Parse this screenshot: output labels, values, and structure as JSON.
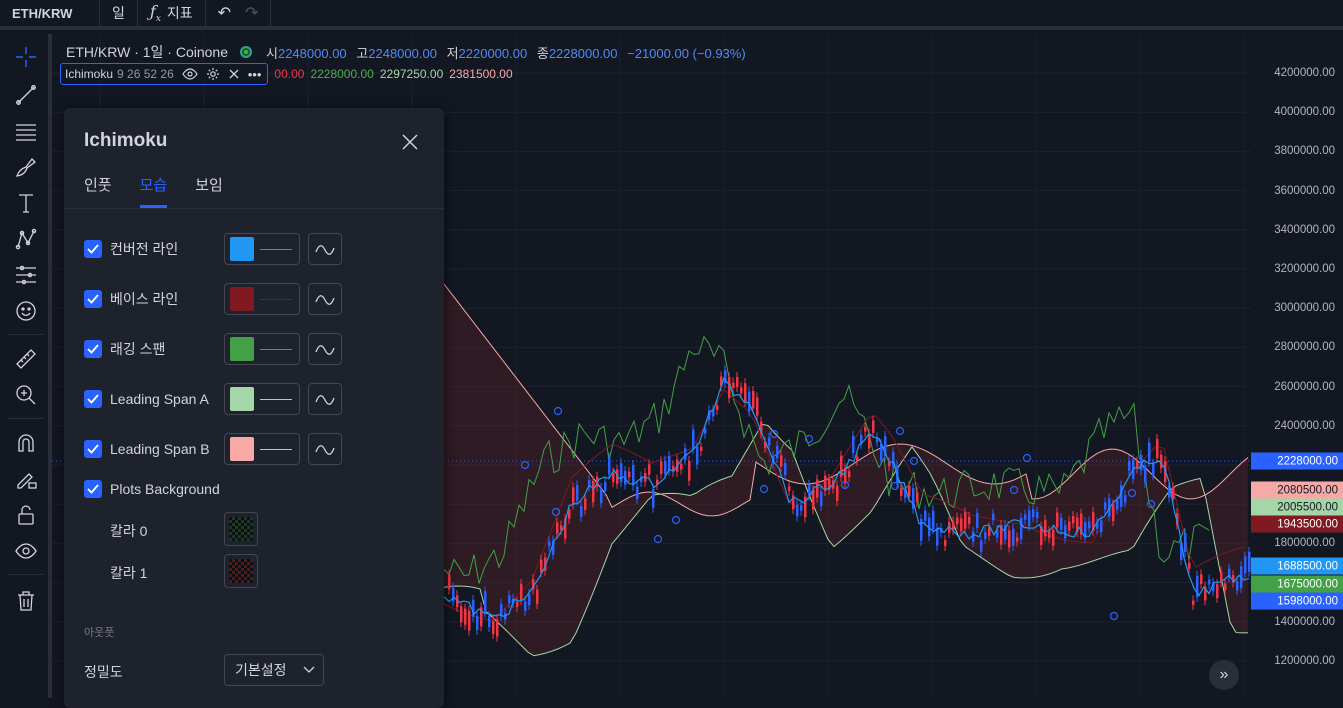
{
  "topbar": {
    "symbol": "ETH/KRW",
    "interval": "일",
    "indicators_label": "지표"
  },
  "legend": {
    "title": "ETH/KRW · 1일 · Coinone",
    "open_label": "시",
    "open": "2248000.00",
    "high_label": "고",
    "high": "2248000.00",
    "low_label": "저",
    "low": "2220000.00",
    "close_label": "종",
    "close": "2228000.00",
    "change": "−21000.00 (−0.93%)"
  },
  "indicator": {
    "name": "Ichimoku",
    "params": "9 26 52 26",
    "values": [
      {
        "text": "00.00",
        "color": "#f23645"
      },
      {
        "text": "2228000.00",
        "color": "#4caf50"
      },
      {
        "text": "2297250.00",
        "color": "#a5d6a7"
      },
      {
        "text": "2381500.00",
        "color": "#f7a9a8"
      }
    ]
  },
  "price_axis": {
    "labels": [
      "4200000.00",
      "4000000.00",
      "3800000.00",
      "3600000.00",
      "3400000.00",
      "3200000.00",
      "3000000.00",
      "2800000.00",
      "2600000.00",
      "2400000.00",
      "1800000.00",
      "1400000.00",
      "1200000.00"
    ],
    "tags": [
      {
        "text": "2228000.00",
        "bg": "#2962ff",
        "fg": "#ffffff"
      },
      {
        "text": "2080500.00",
        "bg": "#f7a9a8",
        "fg": "#131722"
      },
      {
        "text": "2005500.00",
        "bg": "#a5d6a7",
        "fg": "#131722"
      },
      {
        "text": "1943500.00",
        "bg": "#801922",
        "fg": "#ffffff"
      },
      {
        "text": "1688500.00",
        "bg": "#2196f3",
        "fg": "#ffffff"
      },
      {
        "text": "1675000.00",
        "bg": "#43a047",
        "fg": "#ffffff"
      },
      {
        "text": "1598000.00",
        "bg": "#2962ff",
        "fg": "#ffffff"
      }
    ]
  },
  "dialog": {
    "title": "Ichimoku",
    "tabs": [
      "인풋",
      "모습",
      "보임"
    ],
    "active_tab": "모습",
    "lines": [
      {
        "label": "컨버전 라인",
        "color": "#2196f3"
      },
      {
        "label": "베이스 라인",
        "color": "#801922"
      },
      {
        "label": "래깅 스팬",
        "color": "#43a047"
      },
      {
        "label": "Leading Span A",
        "color": "#a5d6a7"
      },
      {
        "label": "Leading Span B",
        "color": "#f7a9a8"
      }
    ],
    "plots_background": "Plots Background",
    "color0_label": "칼라 0",
    "color1_label": "칼라 1",
    "color0": "#1b3a1e",
    "color1": "#4a1c1c",
    "outputs_label": "아웃풋",
    "precision_label": "정밀도",
    "precision_value": "기본설정"
  }
}
